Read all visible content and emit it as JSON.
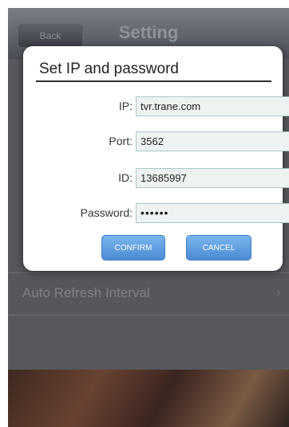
{
  "navbar": {
    "back_label": "Back",
    "title": "Setting"
  },
  "list": {
    "auto_refresh_label": "Auto Refresh Interval",
    "chevron": "›"
  },
  "dialog": {
    "title": "Set IP and password",
    "fields": {
      "ip": {
        "label": "IP:",
        "value": "tvr.trane.com"
      },
      "port": {
        "label": "Port:",
        "value": "3562"
      },
      "id": {
        "label": "ID:",
        "value": "13685997"
      },
      "password": {
        "label": "Password:",
        "value": "••••••"
      }
    },
    "confirm_label": "CONFIRM",
    "cancel_label": "CANCEL"
  }
}
